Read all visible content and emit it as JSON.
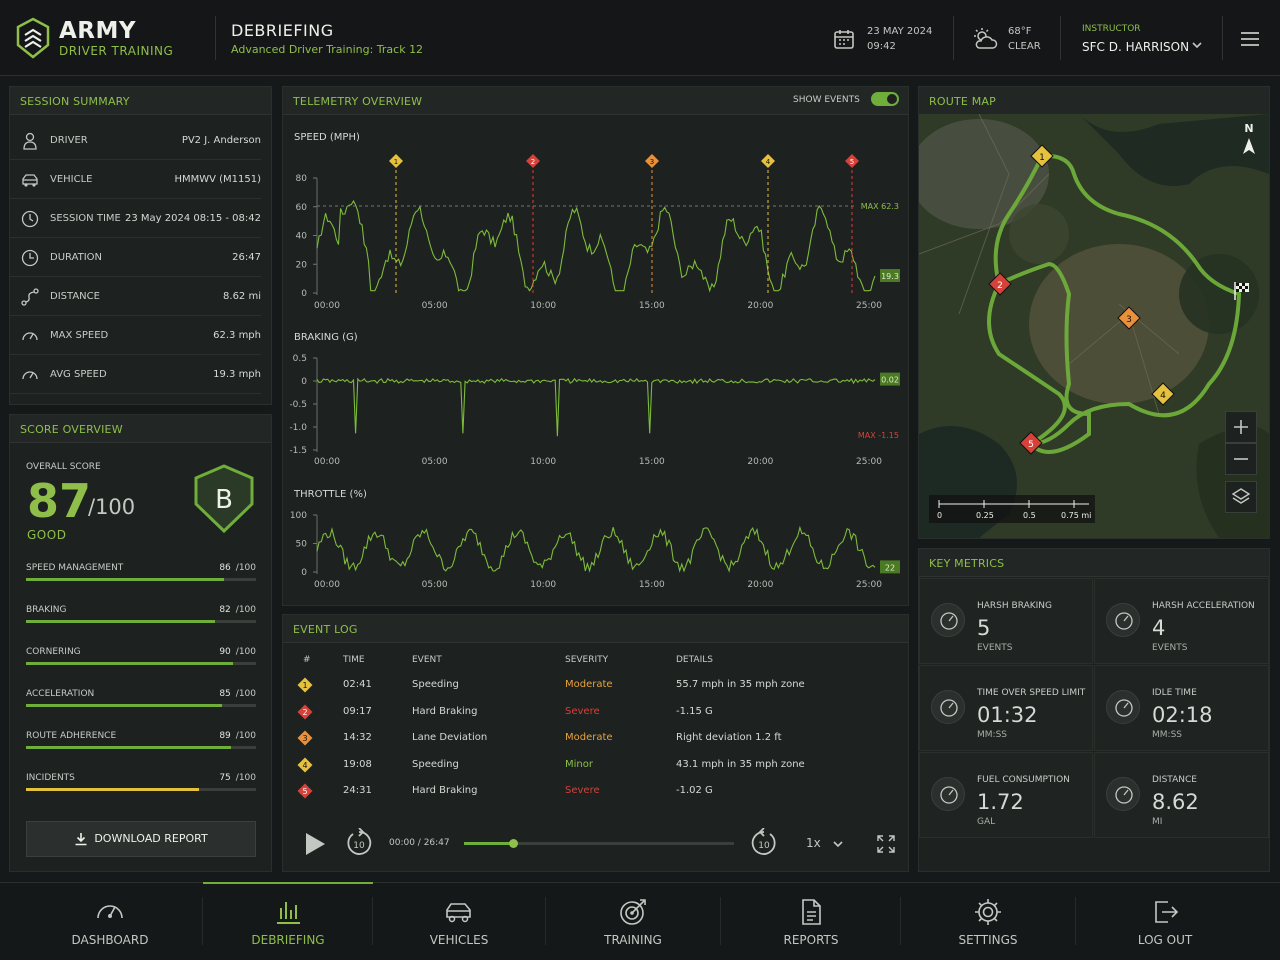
{
  "header": {
    "brand_top": "ARMY",
    "brand_bottom": "DRIVER TRAINING",
    "title": "DEBRIEFING",
    "subtitle": "Advanced Driver Training: Track 12",
    "date": "23 MAY 2024",
    "time": "09:42",
    "temp": "68°F",
    "weather": "CLEAR",
    "instructor_label": "INSTRUCTOR",
    "instructor_name": "SFC D. HARRISON",
    "icons": [
      "calendar-icon",
      "weather-icon",
      "chevron-down-icon",
      "menu-icon"
    ]
  },
  "session": {
    "title": "SESSION SUMMARY",
    "rows": [
      {
        "label": "DRIVER",
        "value": "PV2 J. Anderson",
        "icon": "driver-icon"
      },
      {
        "label": "VEHICLE",
        "value": "HMMWV (M1151)",
        "icon": "vehicle-icon"
      },
      {
        "label": "SESSION TIME",
        "value": "23 May 2024   08:15 - 08:42",
        "icon": "clock-icon"
      },
      {
        "label": "DURATION",
        "value": "26:47",
        "icon": "timer-icon"
      },
      {
        "label": "DISTANCE",
        "value": "8.62 mi",
        "icon": "route-icon"
      },
      {
        "label": "MAX SPEED",
        "value": "62.3 mph",
        "icon": "gauge-icon"
      },
      {
        "label": "AVG SPEED",
        "value": "19.3 mph",
        "icon": "gauge-icon"
      }
    ]
  },
  "score": {
    "title": "SCORE OVERVIEW",
    "overall_label": "OVERALL SCORE",
    "overall": "87",
    "denom": "/100",
    "rating": "GOOD",
    "grade": "B",
    "items": [
      {
        "label": "SPEED MANAGEMENT",
        "score": "86",
        "max": "/100",
        "pct": 0.86,
        "color": "#6fae3a"
      },
      {
        "label": "BRAKING",
        "score": "82",
        "max": "/100",
        "pct": 0.82,
        "color": "#6fae3a"
      },
      {
        "label": "CORNERING",
        "score": "90",
        "max": "/100",
        "pct": 0.9,
        "color": "#6fae3a"
      },
      {
        "label": "ACCELERATION",
        "score": "85",
        "max": "/100",
        "pct": 0.85,
        "color": "#6fae3a"
      },
      {
        "label": "ROUTE ADHERENCE",
        "score": "89",
        "max": "/100",
        "pct": 0.89,
        "color": "#6fae3a"
      },
      {
        "label": "INCIDENTS",
        "score": "75",
        "max": "/100",
        "pct": 0.75,
        "color": "#e5c13d"
      }
    ],
    "download_label": "DOWNLOAD REPORT"
  },
  "telemetry": {
    "title": "TELEMETRY OVERVIEW",
    "toggle_label": "SHOW EVENTS",
    "show_events": true,
    "speed_title": "SPEED (MPH)",
    "braking_title": "BRAKING (G)",
    "throttle_title": "THROTTLE (%)"
  },
  "chart_data": [
    {
      "type": "line",
      "title": "SPEED (MPH)",
      "x_ticks": [
        "00:00",
        "05:00",
        "10:00",
        "15:00",
        "20:00",
        "25:00"
      ],
      "y_ticks": [
        "80",
        "60",
        "40",
        "20",
        "0"
      ],
      "ylim": [
        0,
        80
      ],
      "max_label": "MAX 62.3",
      "current": "19.3",
      "events": [
        {
          "n": "1",
          "t": "02:41",
          "color": "#e5c13d"
        },
        {
          "n": "2",
          "t": "09:17",
          "color": "#d6413a"
        },
        {
          "n": "3",
          "t": "14:32",
          "color": "#e8903a"
        },
        {
          "n": "4",
          "t": "19:08",
          "color": "#e5c13d"
        },
        {
          "n": "5",
          "t": "24:31",
          "color": "#d6413a"
        }
      ]
    },
    {
      "type": "line",
      "title": "BRAKING (G)",
      "x_ticks": [
        "00:00",
        "05:00",
        "10:00",
        "15:00",
        "20:00",
        "25:00"
      ],
      "y_ticks": [
        "0.5",
        "0",
        "-0.5",
        "-1.0",
        "-1.5"
      ],
      "ylim": [
        -1.5,
        0.5
      ],
      "max_label": "MAX -1.15",
      "current": "0.02"
    },
    {
      "type": "line",
      "title": "THROTTLE (%)",
      "x_ticks": [
        "00:00",
        "05:00",
        "10:00",
        "15:00",
        "20:00",
        "25:00"
      ],
      "y_ticks": [
        "100",
        "50",
        "0"
      ],
      "ylim": [
        0,
        100
      ],
      "current": "22"
    }
  ],
  "events": {
    "title": "EVENT LOG",
    "headers": [
      "#",
      "TIME",
      "EVENT",
      "SEVERITY",
      "DETAILS"
    ],
    "rows": [
      {
        "n": "1",
        "time": "02:41",
        "event": "Speeding",
        "severity": "Moderate",
        "sev_color": "#e8a23a",
        "details": "55.7 mph in 35 mph zone",
        "color": "#e5c13d"
      },
      {
        "n": "2",
        "time": "09:17",
        "event": "Hard Braking",
        "severity": "Severe",
        "sev_color": "#d6413a",
        "details": "-1.15 G",
        "color": "#d6413a"
      },
      {
        "n": "3",
        "time": "14:32",
        "event": "Lane Deviation",
        "severity": "Moderate",
        "sev_color": "#e8a23a",
        "details": "Right deviation 1.2 ft",
        "color": "#e8903a"
      },
      {
        "n": "4",
        "time": "19:08",
        "event": "Speeding",
        "severity": "Minor",
        "sev_color": "#8fbf4a",
        "details": "43.1 mph in 35 mph zone",
        "color": "#e5c13d"
      },
      {
        "n": "5",
        "time": "24:31",
        "event": "Hard Braking",
        "severity": "Severe",
        "sev_color": "#d6413a",
        "details": "-1.02 G",
        "color": "#d6413a"
      }
    ],
    "playback": {
      "time": "00:00 / 26:47",
      "progress": 0.18,
      "speed": "1x",
      "skip": "10"
    }
  },
  "map": {
    "title": "ROUTE MAP",
    "north": "N",
    "scale": [
      "0",
      "0.25",
      "0.5",
      "0.75 mi"
    ],
    "markers": [
      "1",
      "2",
      "3",
      "4",
      "5"
    ]
  },
  "metrics": {
    "title": "KEY METRICS",
    "items": [
      {
        "label": "HARSH BRAKING",
        "value": "5",
        "unit": "EVENTS",
        "icon": "speedometer-icon"
      },
      {
        "label": "HARSH ACCELERATION",
        "value": "4",
        "unit": "EVENTS",
        "icon": "acceleration-icon"
      },
      {
        "label": "TIME OVER SPEED LIMIT",
        "value": "01:32",
        "unit": "MM:SS",
        "icon": "overspeed-clock-icon"
      },
      {
        "label": "IDLE TIME",
        "value": "02:18",
        "unit": "MM:SS",
        "icon": "clock-icon"
      },
      {
        "label": "FUEL CONSUMPTION",
        "value": "1.72",
        "unit": "GAL",
        "icon": "fuel-icon"
      },
      {
        "label": "DISTANCE",
        "value": "8.62",
        "unit": "MI",
        "icon": "route-icon"
      }
    ]
  },
  "nav": [
    {
      "label": "DASHBOARD",
      "icon": "dashboard-icon"
    },
    {
      "label": "DEBRIEFING",
      "icon": "chart-icon",
      "active": true
    },
    {
      "label": "VEHICLES",
      "icon": "vehicle-icon"
    },
    {
      "label": "TRAINING",
      "icon": "target-icon"
    },
    {
      "label": "REPORTS",
      "icon": "document-icon"
    },
    {
      "label": "SETTINGS",
      "icon": "gear-icon"
    },
    {
      "label": "LOG OUT",
      "icon": "logout-icon"
    }
  ]
}
